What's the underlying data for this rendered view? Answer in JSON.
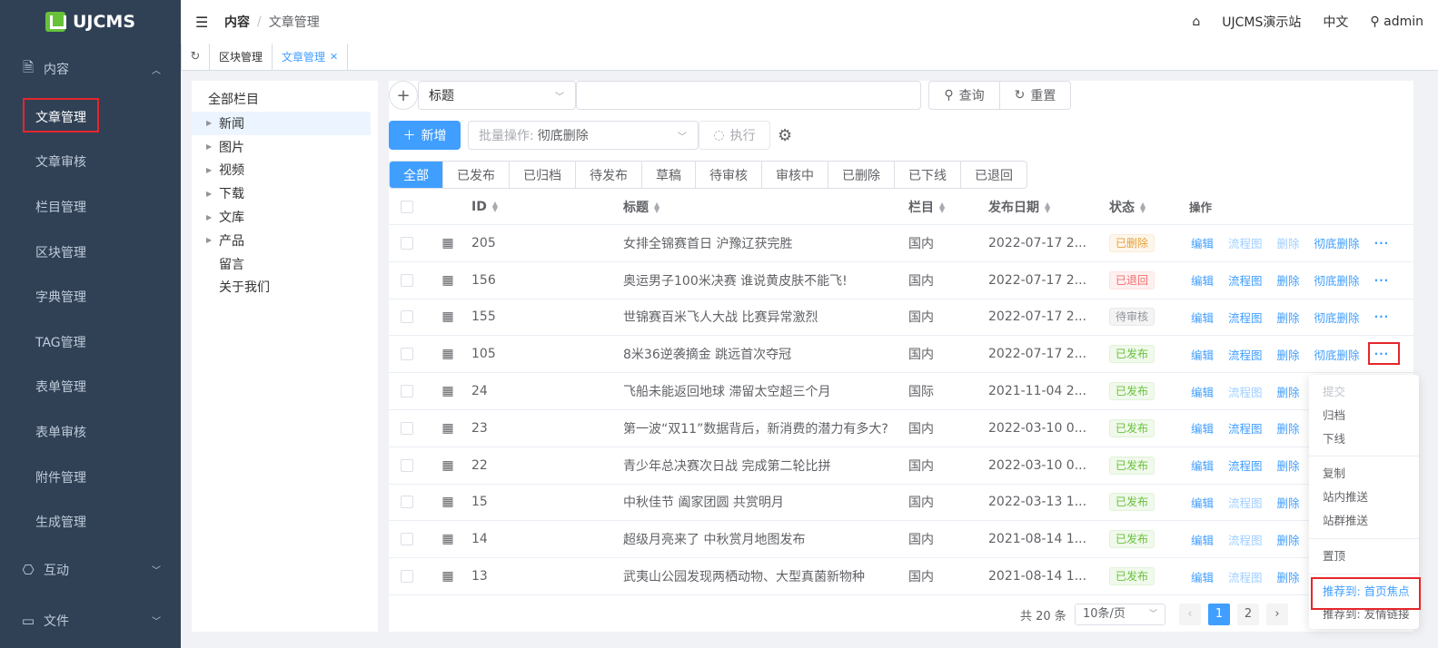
{
  "app": {
    "logo_text": "UJCMS"
  },
  "sidebar": {
    "groups": [
      {
        "label": "内容",
        "icon": "document-icon"
      },
      {
        "label": "互动",
        "icon": "chat-icon"
      },
      {
        "label": "文件",
        "icon": "folder-icon"
      }
    ],
    "items": [
      {
        "label": "文章管理"
      },
      {
        "label": "文章审核"
      },
      {
        "label": "栏目管理"
      },
      {
        "label": "区块管理"
      },
      {
        "label": "字典管理"
      },
      {
        "label": "TAG管理"
      },
      {
        "label": "表单管理"
      },
      {
        "label": "表单审核"
      },
      {
        "label": "附件管理"
      },
      {
        "label": "生成管理"
      }
    ]
  },
  "header": {
    "breadcrumb": [
      "内容",
      "文章管理"
    ],
    "site": "UJCMS演示站",
    "lang": "中文",
    "user": "admin"
  },
  "tabs": [
    {
      "label": "区块管理"
    },
    {
      "label": "文章管理"
    }
  ],
  "tree": {
    "root": "全部栏目",
    "nodes": [
      {
        "label": "新闻"
      },
      {
        "label": "图片"
      },
      {
        "label": "视频"
      },
      {
        "label": "下载"
      },
      {
        "label": "文库"
      },
      {
        "label": "产品"
      },
      {
        "label": "留言"
      },
      {
        "label": "关于我们"
      }
    ]
  },
  "search": {
    "field": "标题",
    "value": "",
    "query_label": "查询",
    "reset_label": "重置"
  },
  "toolbar": {
    "add_label": "新增",
    "batch_label": "批量操作:",
    "batch_value": "彻底删除",
    "exec_label": "执行"
  },
  "status_tabs": [
    "全部",
    "已发布",
    "已归档",
    "待发布",
    "草稿",
    "待审核",
    "审核中",
    "已删除",
    "已下线",
    "已退回"
  ],
  "table": {
    "headers": {
      "id": "ID",
      "title": "标题",
      "channel": "栏目",
      "date": "发布日期",
      "status": "状态",
      "ops": "操作"
    },
    "op_labels": {
      "edit": "编辑",
      "flow": "流程图",
      "delete": "删除",
      "purge": "彻底删除",
      "more": "···"
    },
    "rows": [
      {
        "id": "205",
        "title": "女排全锦赛首日 沪豫辽获完胜",
        "channel": "国内",
        "date": "2022-07-17 2...",
        "status": "已删除"
      },
      {
        "id": "156",
        "title": "奥运男子100米决赛 谁说黄皮肤不能飞!",
        "channel": "国内",
        "date": "2022-07-17 2...",
        "status": "已退回"
      },
      {
        "id": "155",
        "title": "世锦赛百米飞人大战 比赛异常激烈",
        "channel": "国内",
        "date": "2022-07-17 2...",
        "status": "待审核"
      },
      {
        "id": "105",
        "title": "8米36逆袭摘金 跳远首次夺冠",
        "channel": "国内",
        "date": "2022-07-17 2...",
        "status": "已发布"
      },
      {
        "id": "24",
        "title": "飞船未能返回地球 滞留太空超三个月",
        "channel": "国际",
        "date": "2021-11-04 2...",
        "status": "已发布"
      },
      {
        "id": "23",
        "title": "第一波“双11”数据背后，新消费的潜力有多大?",
        "channel": "国内",
        "date": "2022-03-10 0...",
        "status": "已发布"
      },
      {
        "id": "22",
        "title": "青少年总决赛次日战 完成第二轮比拼",
        "channel": "国内",
        "date": "2022-03-10 0...",
        "status": "已发布"
      },
      {
        "id": "15",
        "title": "中秋佳节 阖家团圆 共赏明月",
        "channel": "国内",
        "date": "2022-03-13 1...",
        "status": "已发布"
      },
      {
        "id": "14",
        "title": "超级月亮来了 中秋赏月地图发布",
        "channel": "国内",
        "date": "2021-08-14 1...",
        "status": "已发布"
      },
      {
        "id": "13",
        "title": "武夷山公园发现两栖动物、大型真菌新物种",
        "channel": "国内",
        "date": "2021-08-14 1...",
        "status": "已发布"
      }
    ]
  },
  "pagination": {
    "total": "共 20 条",
    "page_size": "10条/页",
    "pages": [
      "1",
      "2"
    ],
    "current": 1
  },
  "popup": {
    "items": [
      "提交",
      "归档",
      "下线",
      "复制",
      "站内推送",
      "站群推送",
      "置顶",
      "推荐到: 首页焦点",
      "推荐到: 友情链接"
    ]
  },
  "colors": {
    "primary": "#409eff",
    "sidebar_bg": "#304156",
    "highlight": "#e5262b"
  }
}
